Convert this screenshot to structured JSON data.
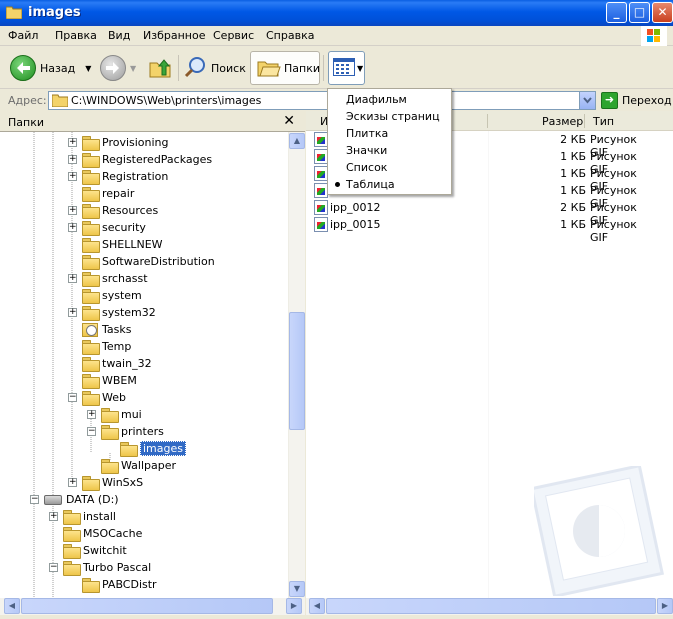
{
  "window": {
    "title": "images"
  },
  "menubar": {
    "items": [
      "Файл",
      "Правка",
      "Вид",
      "Избранное",
      "Сервис",
      "Справка"
    ]
  },
  "toolbar": {
    "back_label": "Назад",
    "search_label": "Поиск",
    "folders_label": "Папки"
  },
  "address": {
    "label": "Адрес:",
    "path": "C:\\WINDOWS\\Web\\printers\\images",
    "go_label": "Переход"
  },
  "folders_pane": {
    "title": "Папки",
    "items": [
      {
        "label": "Provisioning",
        "expander": "+"
      },
      {
        "label": "RegisteredPackages",
        "expander": "+"
      },
      {
        "label": "Registration",
        "expander": "+"
      },
      {
        "label": "repair",
        "expander": ""
      },
      {
        "label": "Resources",
        "expander": "+"
      },
      {
        "label": "security",
        "expander": "+"
      },
      {
        "label": "SHELLNEW",
        "expander": ""
      },
      {
        "label": "SoftwareDistribution",
        "expander": ""
      },
      {
        "label": "srchasst",
        "expander": "+"
      },
      {
        "label": "system",
        "expander": ""
      },
      {
        "label": "system32",
        "expander": "+"
      },
      {
        "label": "Tasks",
        "expander": ""
      },
      {
        "label": "Temp",
        "expander": ""
      },
      {
        "label": "twain_32",
        "expander": ""
      },
      {
        "label": "WBEM",
        "expander": ""
      },
      {
        "label": "Web",
        "expander": "−"
      },
      {
        "label": "mui",
        "expander": "+"
      },
      {
        "label": "printers",
        "expander": "−"
      },
      {
        "label": "images",
        "expander": ""
      },
      {
        "label": "Wallpaper",
        "expander": ""
      },
      {
        "label": "WinSxS",
        "expander": "+"
      },
      {
        "label": "DATA (D:)",
        "expander": "−"
      },
      {
        "label": "install",
        "expander": "+"
      },
      {
        "label": "MSOCache",
        "expander": ""
      },
      {
        "label": "Switchit",
        "expander": ""
      },
      {
        "label": "Turbo Pascal",
        "expander": "−"
      },
      {
        "label": "PABCDistr",
        "expander": ""
      }
    ]
  },
  "file_list": {
    "columns": {
      "name": "И",
      "size": "Размер",
      "type": "Тип"
    },
    "rows": [
      {
        "name": "",
        "size": "2 КБ",
        "type": "Рисунок GIF"
      },
      {
        "name": "",
        "size": "1 КБ",
        "type": "Рисунок GIF"
      },
      {
        "name": "",
        "size": "1 КБ",
        "type": "Рисунок GIF"
      },
      {
        "name": "",
        "size": "1 КБ",
        "type": "Рисунок GIF"
      },
      {
        "name": "ipp_0012",
        "size": "2 КБ",
        "type": "Рисунок GIF"
      },
      {
        "name": "ipp_0015",
        "size": "1 КБ",
        "type": "Рисунок GIF"
      }
    ]
  },
  "view_menu": {
    "items": [
      "Диафильм",
      "Эскизы страниц",
      "Плитка",
      "Значки",
      "Список",
      "Таблица"
    ],
    "selected": "Таблица"
  }
}
